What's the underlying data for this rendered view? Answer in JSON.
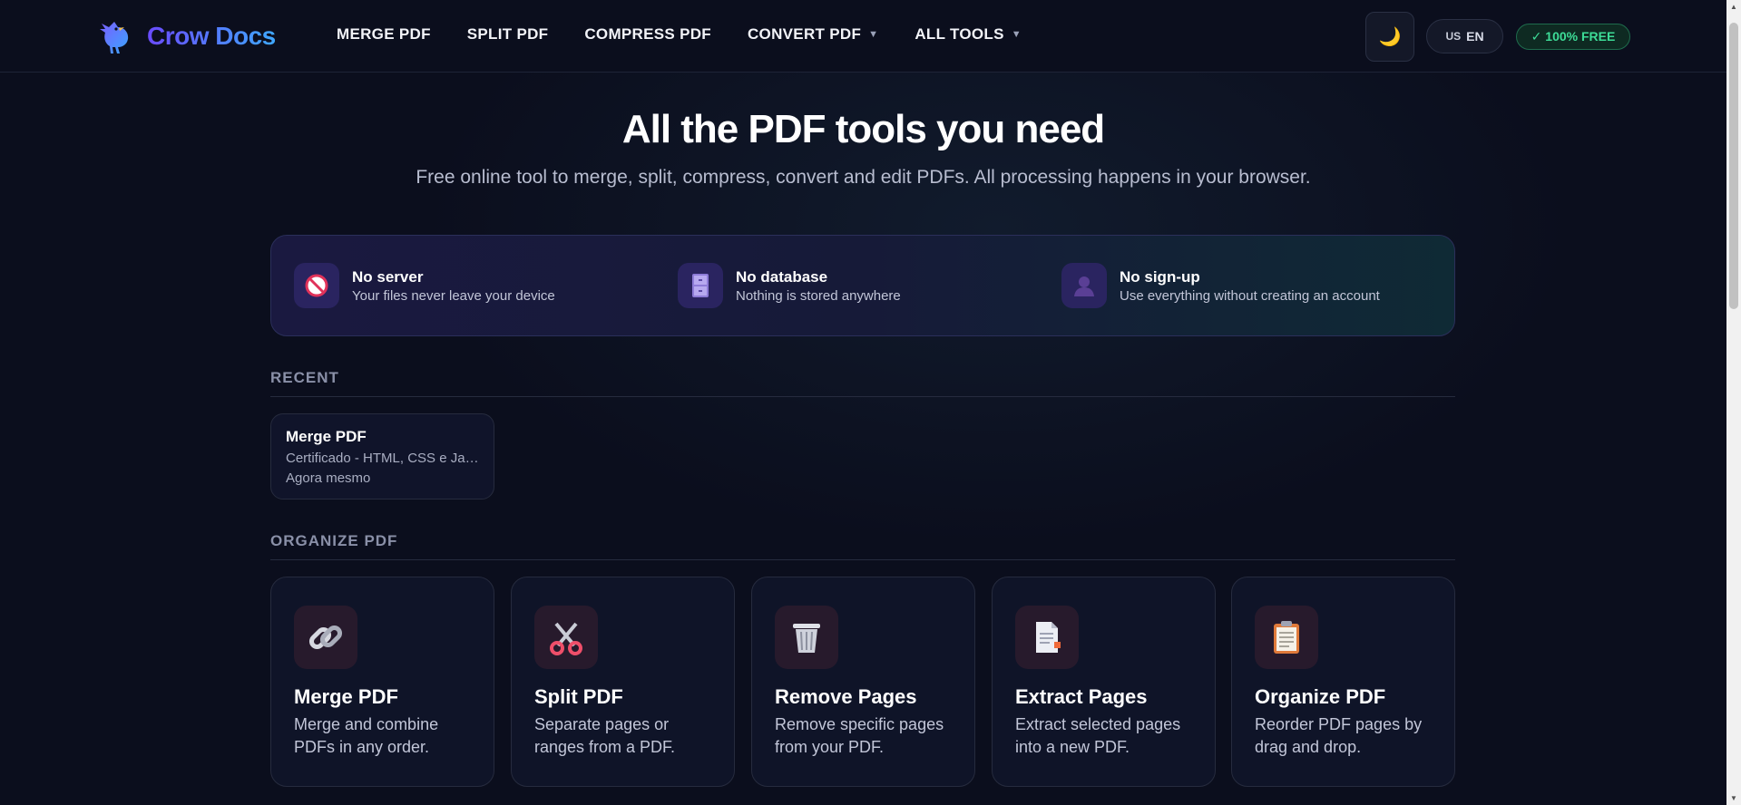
{
  "brand": {
    "name": "Crow Docs",
    "logo_icon": "crow-bird-icon"
  },
  "nav": [
    {
      "label": "MERGE PDF",
      "dropdown": false
    },
    {
      "label": "SPLIT PDF",
      "dropdown": false
    },
    {
      "label": "COMPRESS PDF",
      "dropdown": false
    },
    {
      "label": "CONVERT PDF",
      "dropdown": true
    },
    {
      "label": "ALL TOOLS",
      "dropdown": true
    }
  ],
  "header": {
    "theme_icon": "moon-icon",
    "lang_flag": "US",
    "lang_code": "EN",
    "free_badge": "✓ 100% FREE"
  },
  "hero": {
    "title": "All the PDF tools you need",
    "subtitle": "Free online tool to merge, split, compress, convert and edit PDFs. All processing happens in your browser."
  },
  "features": [
    {
      "icon": "no-entry-icon",
      "title": "No server",
      "desc": "Your files never leave your device"
    },
    {
      "icon": "file-cabinet-icon",
      "title": "No database",
      "desc": "Nothing is stored anywhere"
    },
    {
      "icon": "user-silhouette-icon",
      "title": "No sign-up",
      "desc": "Use everything without creating an account"
    }
  ],
  "recent": {
    "label": "RECENT",
    "items": [
      {
        "title": "Merge PDF",
        "file": "Certificado - HTML, CSS e JavaScript",
        "time": "Agora mesmo"
      }
    ]
  },
  "organize": {
    "label": "ORGANIZE PDF",
    "tools": [
      {
        "icon": "link-icon",
        "title": "Merge PDF",
        "desc": "Merge and combine PDFs in any order."
      },
      {
        "icon": "scissors-icon",
        "title": "Split PDF",
        "desc": "Separate pages or ranges from a PDF."
      },
      {
        "icon": "trash-icon",
        "title": "Remove Pages",
        "desc": "Remove specific pages from your PDF."
      },
      {
        "icon": "page-extract-icon",
        "title": "Extract Pages",
        "desc": "Extract selected pages into a new PDF."
      },
      {
        "icon": "clipboard-icon",
        "title": "Organize PDF",
        "desc": "Reorder PDF pages by drag and drop."
      }
    ]
  },
  "colors": {
    "background": "#0b0e1d",
    "brand_gradient_start": "#6a4bff",
    "brand_gradient_end": "#3fa8ff",
    "free_badge": "#3ddc97"
  }
}
